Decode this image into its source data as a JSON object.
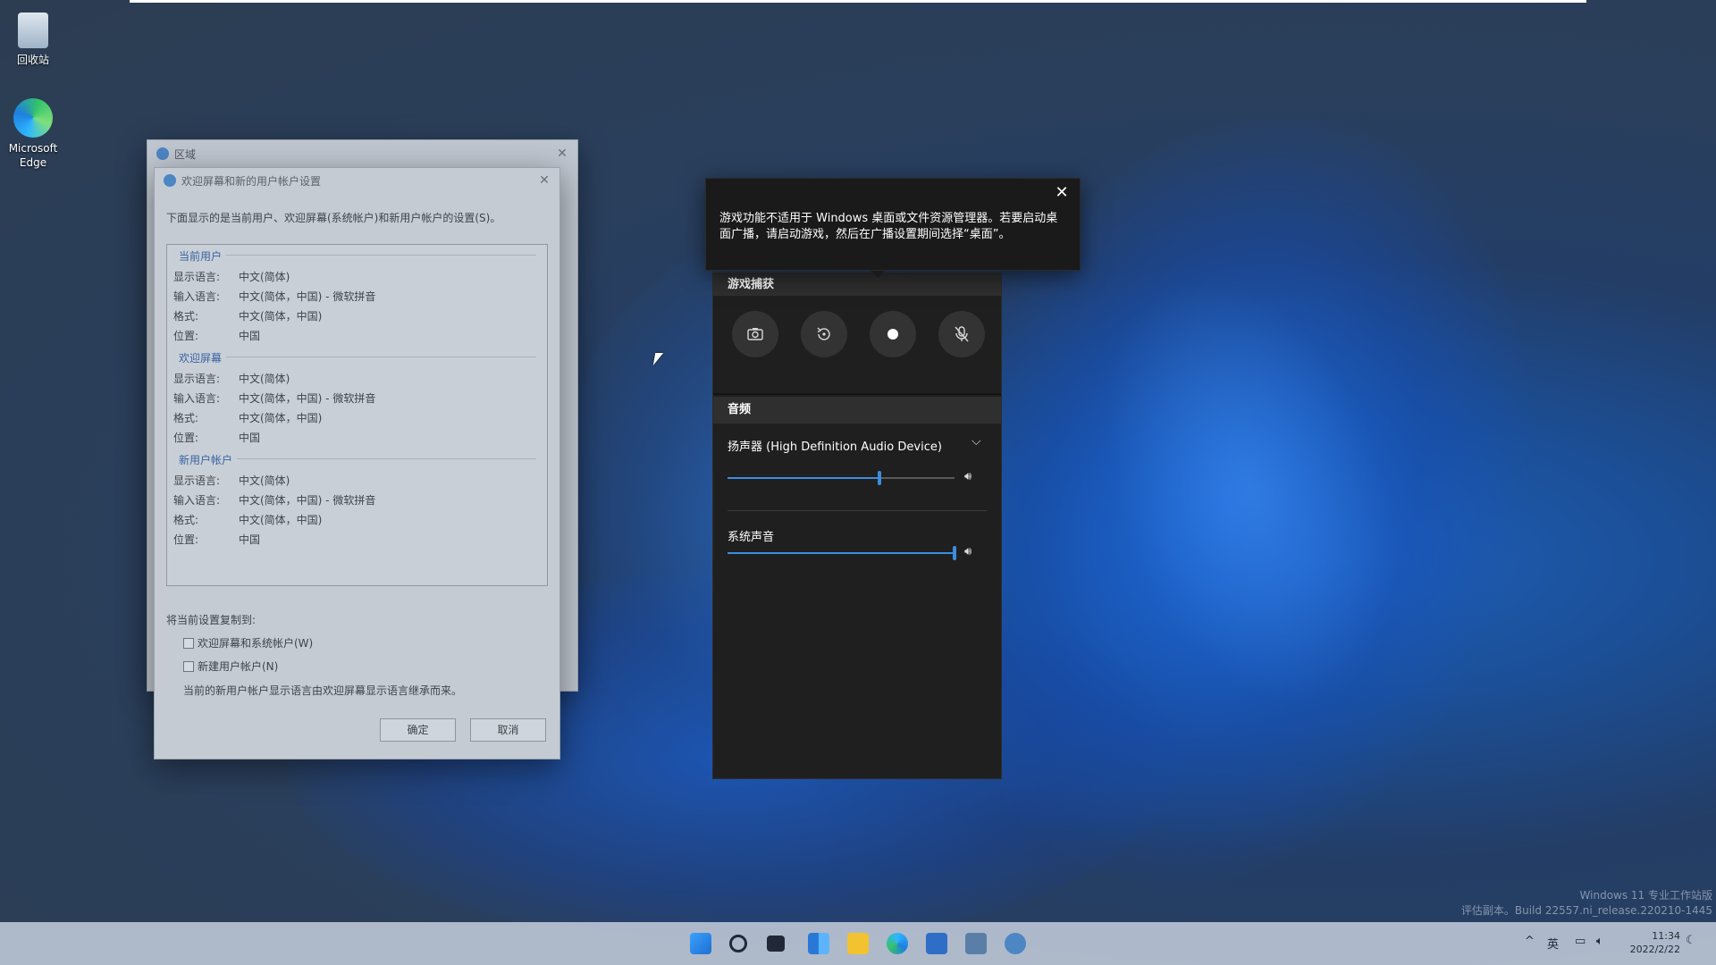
{
  "desktop": {
    "icons": [
      {
        "label": "回收站"
      },
      {
        "label": "Microsoft Edge"
      }
    ]
  },
  "region_dialog": {
    "title": "区域"
  },
  "welcome_dialog": {
    "title": "欢迎屏幕和新的用户帐户设置",
    "intro": "下面显示的是当前用户、欢迎屏幕(系统帐户)和新用户帐户的设置(S)。",
    "groups": [
      {
        "heading": "当前用户",
        "rows": [
          {
            "k": "显示语言:",
            "v": "中文(简体)"
          },
          {
            "k": "输入语言:",
            "v": "中文(简体，中国) - 微软拼音"
          },
          {
            "k": "格式:",
            "v": "中文(简体，中国)"
          },
          {
            "k": "位置:",
            "v": "中国"
          }
        ]
      },
      {
        "heading": "欢迎屏幕",
        "rows": [
          {
            "k": "显示语言:",
            "v": "中文(简体)"
          },
          {
            "k": "输入语言:",
            "v": "中文(简体，中国) - 微软拼音"
          },
          {
            "k": "格式:",
            "v": "中文(简体，中国)"
          },
          {
            "k": "位置:",
            "v": "中国"
          }
        ]
      },
      {
        "heading": "新用户帐户",
        "rows": [
          {
            "k": "显示语言:",
            "v": "中文(简体)"
          },
          {
            "k": "输入语言:",
            "v": "中文(简体，中国) - 微软拼音"
          },
          {
            "k": "格式:",
            "v": "中文(简体，中国)"
          },
          {
            "k": "位置:",
            "v": "中国"
          }
        ]
      }
    ],
    "copy_label": "将当前设置复制到:",
    "checkbox_welcome": "欢迎屏幕和系统帐户(W)",
    "checkbox_new_user": "新建用户帐户(N)",
    "note": "当前的新用户帐户显示语言由欢迎屏幕显示语言继承而来。",
    "ok_label": "确定",
    "cancel_label": "取消"
  },
  "gamebar": {
    "tooltip": "游戏功能不适用于 Windows 桌面或文件资源管理器。若要启动桌面广播，请启动游戏，然后在广播设置期间选择“桌面”。",
    "capture_header": "游戏捕获",
    "capture_icons": [
      "camera-icon",
      "replay-icon",
      "record-icon",
      "mic-off-icon"
    ],
    "audio_header": "音频",
    "device_label": "扬声器 (High Definition Audio Device)",
    "device_volume": 0.67,
    "system_label": "系统声音",
    "system_volume": 1.0,
    "accent_color": "#3c8de0"
  },
  "watermark": {
    "line1": "Windows 11 专业工作站版",
    "line2": "评估副本。Build 22557.ni_release.220210-1445"
  },
  "taskbar": {
    "tray_lang": "英",
    "time": "11:34",
    "date": "2022/2/22"
  }
}
